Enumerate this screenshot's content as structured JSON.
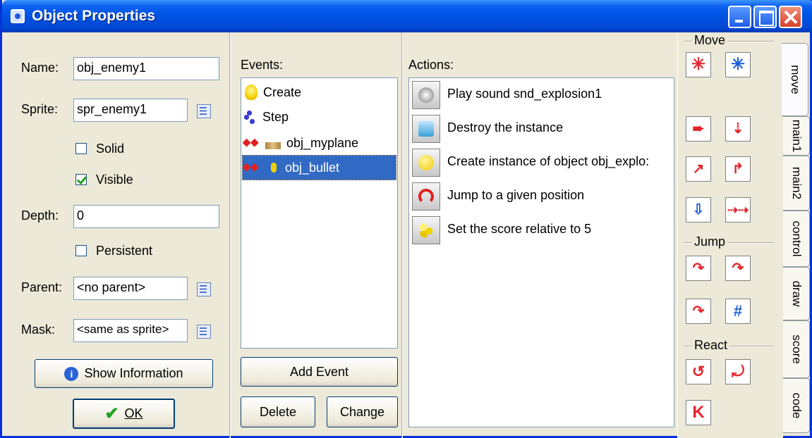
{
  "window": {
    "title": "Object Properties"
  },
  "left": {
    "name_label": "Name:",
    "name_value": "obj_enemy1",
    "sprite_label": "Sprite:",
    "sprite_value": "spr_enemy1",
    "solid_label": "Solid",
    "solid_checked": false,
    "visible_label": "Visible",
    "visible_checked": true,
    "depth_label": "Depth:",
    "depth_value": "0",
    "persistent_label": "Persistent",
    "persistent_checked": false,
    "parent_label": "Parent:",
    "parent_value": "<no parent>",
    "mask_label": "Mask:",
    "mask_value": "<same as sprite>",
    "show_info_label": "Show Information",
    "ok_label": "OK"
  },
  "events": {
    "header": "Events:",
    "items": [
      {
        "label": "Create",
        "icon": "lightbulb-icon"
      },
      {
        "label": "Step",
        "icon": "footsteps-icon"
      },
      {
        "label": "obj_myplane",
        "icon": "collision-icon"
      },
      {
        "label": "obj_bullet",
        "icon": "collision-icon",
        "selected": true
      }
    ],
    "add_label": "Add Event",
    "delete_label": "Delete",
    "change_label": "Change"
  },
  "actions": {
    "header": "Actions:",
    "items": [
      {
        "label": "Play sound snd_explosion1",
        "icon": "speaker-icon"
      },
      {
        "label": "Destroy the instance",
        "icon": "trash-icon"
      },
      {
        "label": "Create instance of object obj_explo:",
        "icon": "lightbulb-icon"
      },
      {
        "label": "Jump to a given position",
        "icon": "jump-icon"
      },
      {
        "label": "Set the score relative to 5",
        "icon": "score-icon"
      }
    ]
  },
  "palette": {
    "move_section": "Move",
    "jump_section": "Jump",
    "react_section": "React"
  },
  "tabs": [
    "move",
    "main1",
    "main2",
    "control",
    "draw",
    "score",
    "code"
  ],
  "colors": {
    "selection": "#316ac5",
    "titlebar": "#0054e3",
    "face": "#ece9d8"
  }
}
